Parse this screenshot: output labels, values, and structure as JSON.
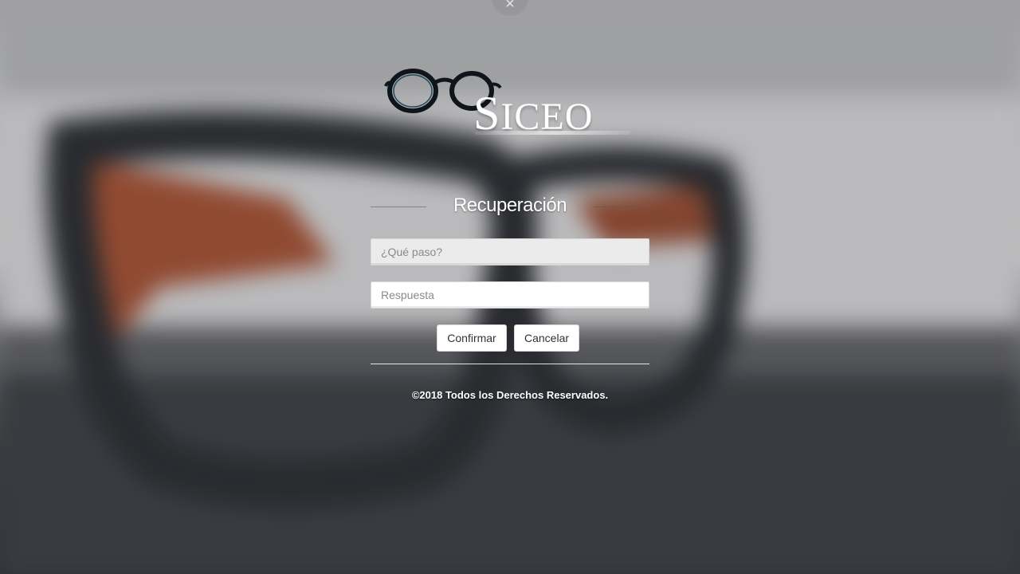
{
  "close_glyph": "×",
  "logo": {
    "text_cap": "S",
    "text_rest": "ICEO",
    "icon": "eyeglasses-icon"
  },
  "form": {
    "heading": "Recuperación",
    "question_placeholder": "¿Qué paso?",
    "answer_placeholder": "Respuesta",
    "confirm_label": "Confirmar",
    "cancel_label": "Cancelar"
  },
  "footer": {
    "copyright": "©2018 Todos los Derechos Reservados."
  },
  "colors": {
    "text_light": "#ffffff",
    "button_bg": "#ffffff",
    "input_question_bg": "#ebebeb"
  }
}
